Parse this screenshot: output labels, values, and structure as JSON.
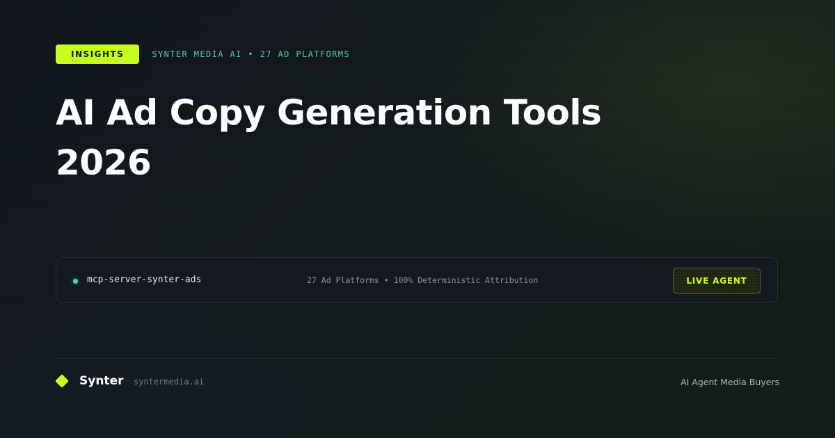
{
  "header": {
    "tag_label": "INSIGHTS",
    "meta_text": "SYNTER MEDIA AI • 27 AD PLATFORMS"
  },
  "headline": {
    "line1": "AI Ad Copy Generation Tools",
    "line2": "2026"
  },
  "terminal": {
    "server_name": "mcp-server-synter-ads",
    "stats": "27 Ad Platforms • 100% Deterministic Attribution",
    "status_label": "LIVE AGENT"
  },
  "footer": {
    "brand_name": "Synter",
    "brand_url": "syntermedia.ai",
    "tagline": "AI Agent Media Buyers"
  },
  "colors": {
    "accent": "#c6ff1f",
    "teal": "#57c7b4",
    "background": "#0f141b"
  },
  "icons": {
    "status_dot": "status-dot-icon",
    "logo": "diamond-logo-icon"
  }
}
